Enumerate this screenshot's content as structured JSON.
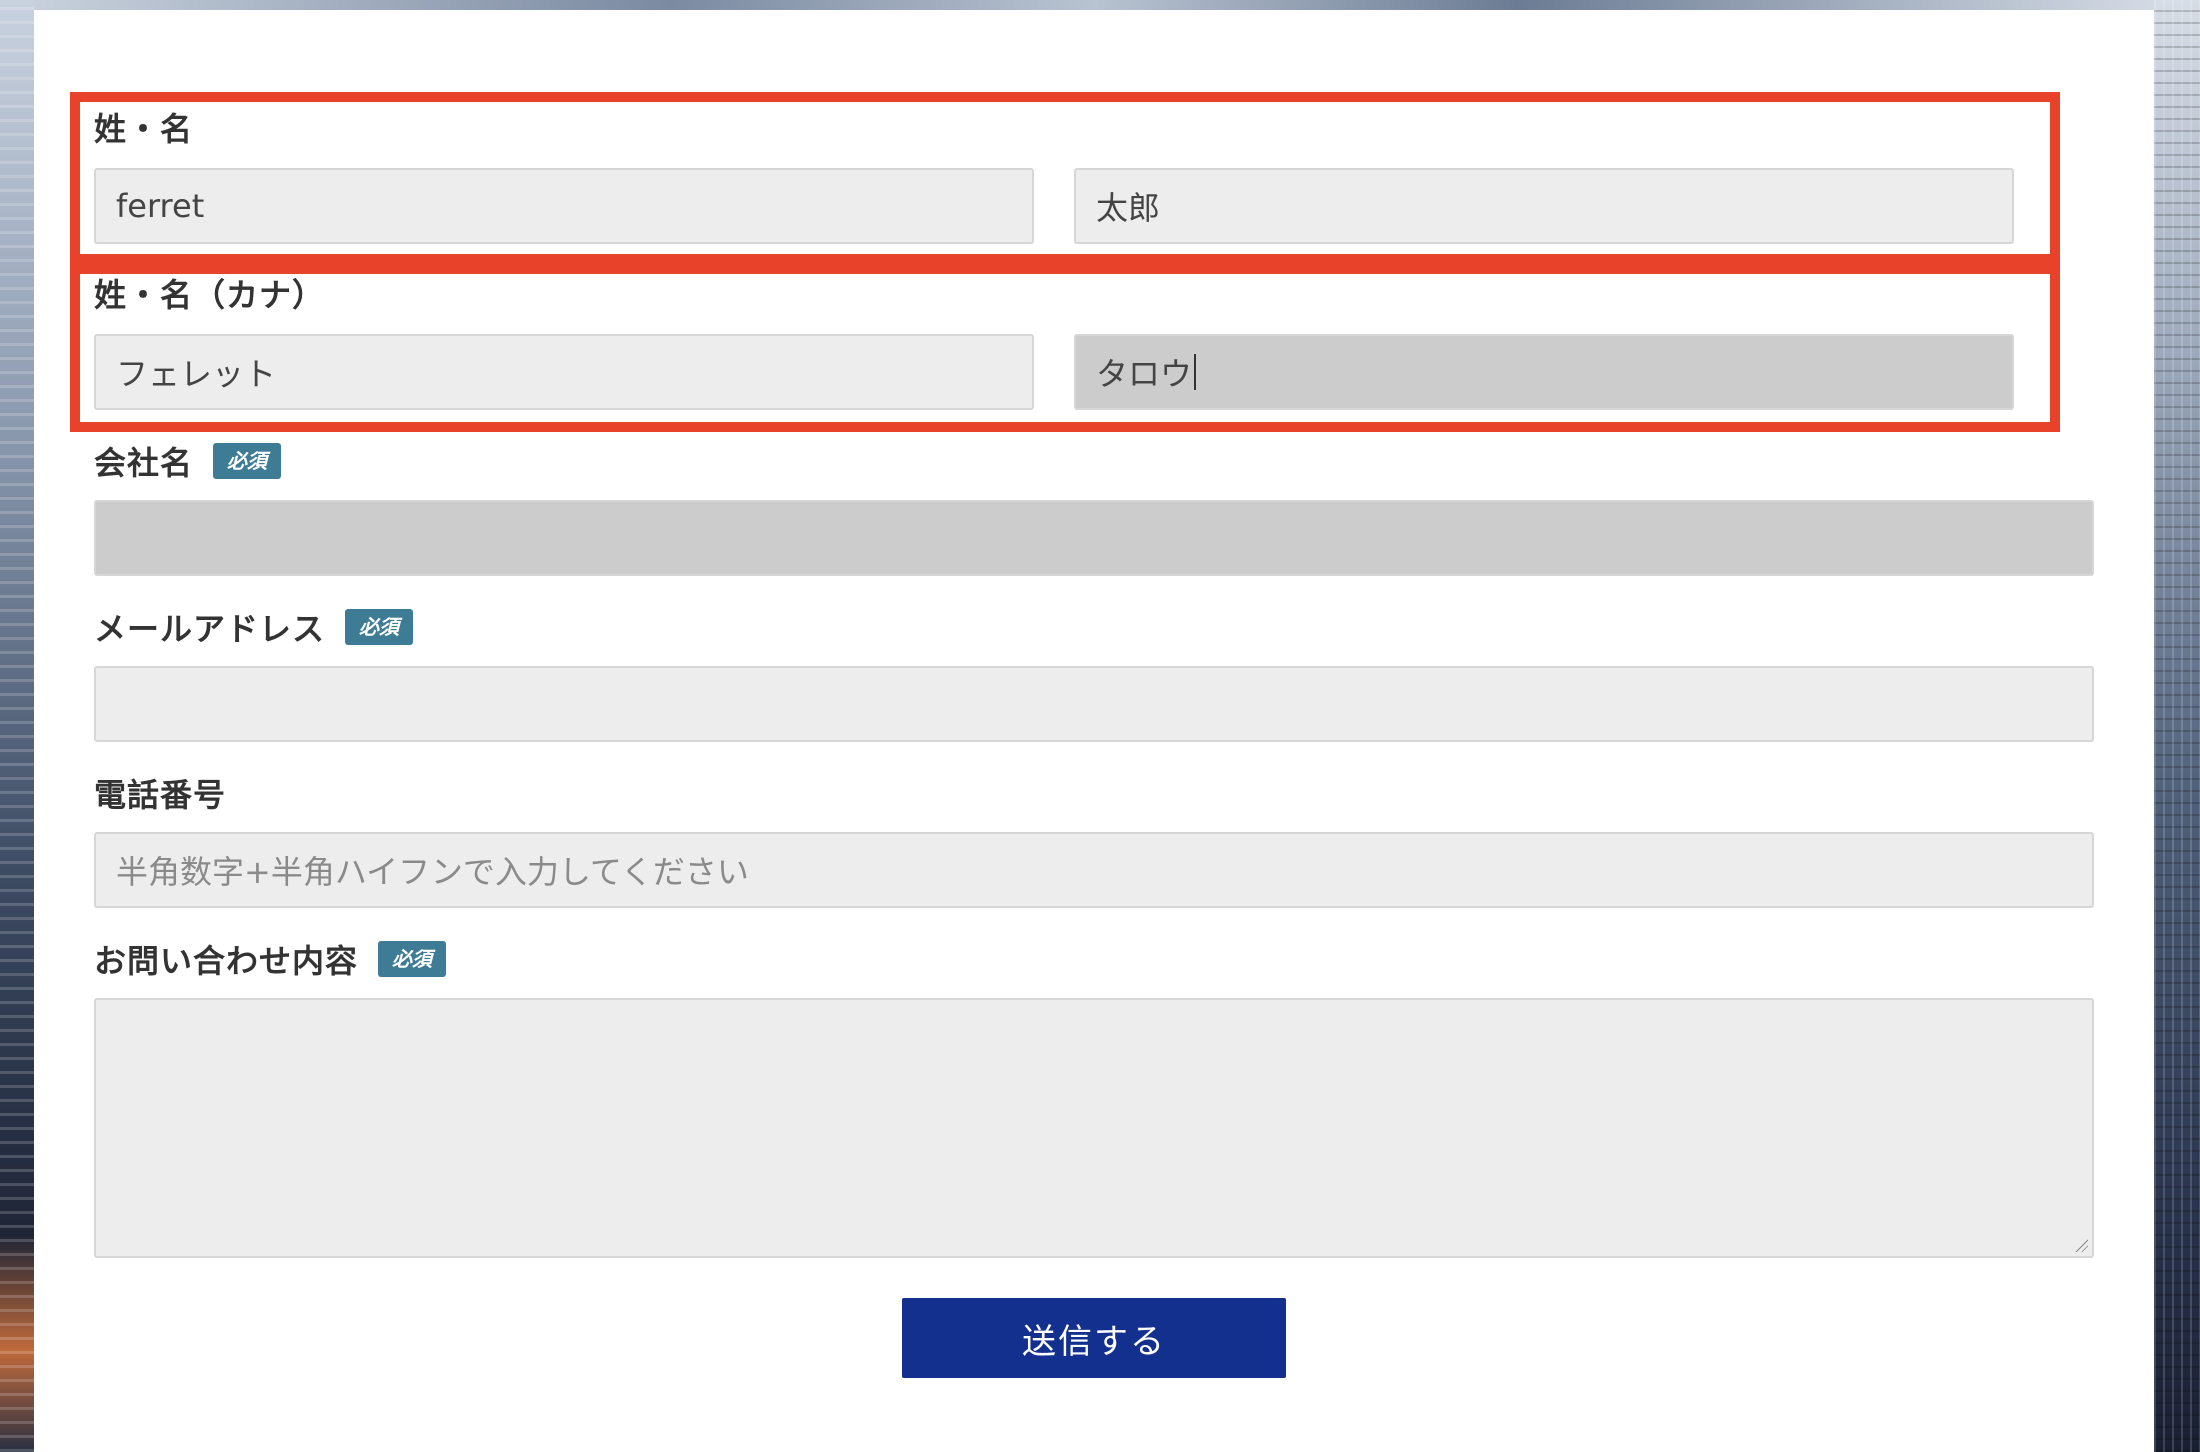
{
  "form": {
    "name": {
      "label": "姓・名",
      "last_value": "ferret",
      "first_value": "太郎"
    },
    "kana": {
      "label": "姓・名（カナ）",
      "last_value": "フェレット",
      "first_value": "タロウ"
    },
    "company": {
      "label": "会社名",
      "badge": "必須",
      "value": ""
    },
    "email": {
      "label": "メールアドレス",
      "badge": "必須",
      "value": ""
    },
    "phone": {
      "label": "電話番号",
      "placeholder": "半角数字+半角ハイフンで入力してください"
    },
    "inquiry": {
      "label": "お問い合わせ内容",
      "badge": "必須",
      "value": ""
    },
    "submit_label": "送信する"
  },
  "colors": {
    "highlight": "#e8432a",
    "badge": "#3e7c96",
    "submit": "#14308f",
    "field_bg": "#ededed",
    "field_focus_bg": "#cccccc"
  }
}
